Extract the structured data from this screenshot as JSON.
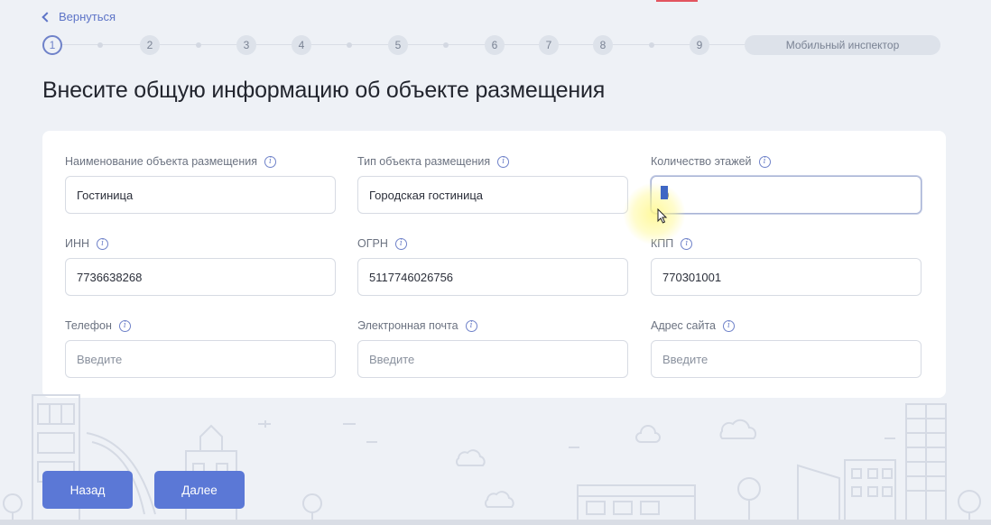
{
  "nav": {
    "back_label": "Вернуться"
  },
  "stepper": {
    "steps": [
      "1",
      "2",
      "3",
      "4",
      "5",
      "6",
      "7",
      "8",
      "9"
    ],
    "active_step": "1",
    "final_label": "Мобильный инспектор"
  },
  "page": {
    "title": "Внесите общую информацию об объекте размещения"
  },
  "form": {
    "name": {
      "label": "Наименование объекта размещения",
      "value": "Гостиница"
    },
    "type": {
      "label": "Тип объекта размещения",
      "value": "Городская гостиница"
    },
    "floors": {
      "label": "Количество этажей",
      "value": "0"
    },
    "inn": {
      "label": "ИНН",
      "value": "7736638268"
    },
    "ogrn": {
      "label": "ОГРН",
      "value": "5117746026756"
    },
    "kpp": {
      "label": "КПП",
      "value": "770301001"
    },
    "phone": {
      "label": "Телефон",
      "placeholder": "Введите"
    },
    "email": {
      "label": "Электронная почта",
      "placeholder": "Введите"
    },
    "site": {
      "label": "Адрес сайта",
      "placeholder": "Введите"
    }
  },
  "actions": {
    "back_button": "Назад",
    "next_button": "Далее"
  },
  "colors": {
    "accent": "#5b78d6",
    "background": "#eef1f6",
    "card": "#ffffff"
  }
}
